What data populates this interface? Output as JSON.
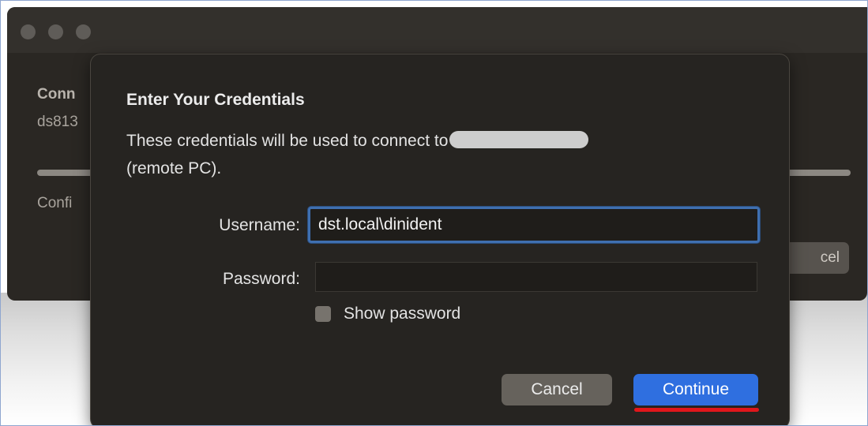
{
  "background_window": {
    "connection_heading": "Conn",
    "host_text": "ds813",
    "status_text": "Confi",
    "cancel_label": "cel"
  },
  "dialog": {
    "title": "Enter Your Credentials",
    "message_prefix": "These credentials will be used to connect to",
    "message_suffix": "(remote PC).",
    "username_label": "Username:",
    "username_value": "dst.local\\dinident",
    "password_label": "Password:",
    "password_value": "",
    "show_password_label": "Show password",
    "show_password_checked": false,
    "cancel_label": "Cancel",
    "continue_label": "Continue"
  },
  "colors": {
    "accent": "#2f6fe0",
    "highlight_mark": "#e0161b",
    "focus_ring": "#3f6fb0"
  }
}
